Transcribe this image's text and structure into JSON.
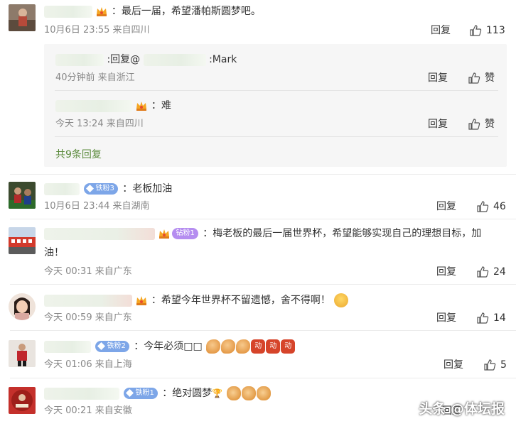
{
  "comments": [
    {
      "text": "：最后一届，希望潘帕斯圆梦吧。",
      "meta": "10月6日 23:55 来自四川",
      "reply_label": "回复",
      "likes": "113",
      "replies": [
        {
          "text": ":回复@",
          "mention_suffix": ":Mark",
          "meta": "40分钟前 来自浙江",
          "reply_label": "回复",
          "like_label": "赞"
        },
        {
          "text": "：难",
          "meta": "今天 13:24 来自四川",
          "reply_label": "回复",
          "like_label": "赞"
        }
      ],
      "more_replies": "共9条回复"
    },
    {
      "badge": "铁粉3",
      "text": "：老板加油",
      "meta": "10月6日 23:44 来自湖南",
      "reply_label": "回复",
      "likes": "46"
    },
    {
      "badge": "钻粉1",
      "text": "：梅老板的最后一届世界杯，希望能够实现自己的理想目标，加",
      "text_cont": "油！",
      "meta": "今天 00:31 来自广东",
      "reply_label": "回复",
      "likes": "24"
    },
    {
      "text": "：希望今年世界杯不留遗憾，舍不得啊！",
      "meta": "今天 00:59 来自广东",
      "reply_label": "回复",
      "likes": "14"
    },
    {
      "badge": "铁粉2",
      "text": "：今年必须□□",
      "emoji_fight": "动",
      "meta": "今天 01:06 来自上海",
      "reply_label": "回复",
      "likes": "5"
    },
    {
      "badge": "铁粉1",
      "text": "：绝对圆梦",
      "trophy": "🏆",
      "meta": "今天 00:21 来自安徽",
      "reply_label": "回复"
    }
  ],
  "watermark": "头条 @体坛报",
  "colors": {
    "link": "#5a8a3b",
    "badge_blue": "#7da6e8",
    "badge_purple": "#b58df0"
  }
}
